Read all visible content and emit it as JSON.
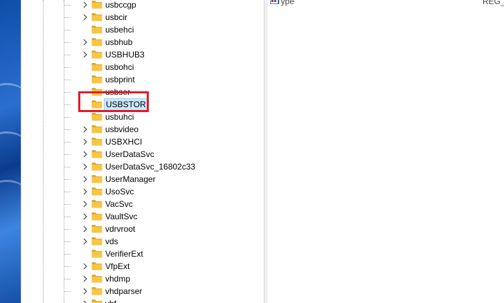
{
  "tree": {
    "items": [
      {
        "label": "usbccgp",
        "expandable": true
      },
      {
        "label": "usbcir",
        "expandable": true
      },
      {
        "label": "usbehci",
        "expandable": false
      },
      {
        "label": "usbhub",
        "expandable": true
      },
      {
        "label": "USBHUB3",
        "expandable": true
      },
      {
        "label": "usbohci",
        "expandable": false
      },
      {
        "label": "usbprint",
        "expandable": false
      },
      {
        "label": "usbser",
        "expandable": false
      },
      {
        "label": "USBSTOR",
        "expandable": false,
        "selected": true
      },
      {
        "label": "usbuhci",
        "expandable": false
      },
      {
        "label": "usbvideo",
        "expandable": true
      },
      {
        "label": "USBXHCI",
        "expandable": true
      },
      {
        "label": "UserDataSvc",
        "expandable": true
      },
      {
        "label": "UserDataSvc_16802c33",
        "expandable": true
      },
      {
        "label": "UserManager",
        "expandable": true
      },
      {
        "label": "UsoSvc",
        "expandable": true
      },
      {
        "label": "VacSvc",
        "expandable": true
      },
      {
        "label": "VaultSvc",
        "expandable": true
      },
      {
        "label": "vdrvroot",
        "expandable": true
      },
      {
        "label": "vds",
        "expandable": true
      },
      {
        "label": "VerifierExt",
        "expandable": false
      },
      {
        "label": "VfpExt",
        "expandable": true
      },
      {
        "label": "vhdmp",
        "expandable": true
      },
      {
        "label": "vhdparser",
        "expandable": true
      },
      {
        "label": "vhf",
        "expandable": true
      }
    ],
    "chevron_icon": "chevron-right-icon",
    "folder_icon": "folder-icon"
  },
  "values": {
    "header_row": {
      "name": "Type",
      "type": "REG_D"
    }
  },
  "colors": {
    "folder": "#f6c644",
    "folder_dark": "#e0a82e",
    "selection": "#cce8ff",
    "highlight": "#e21a28"
  }
}
